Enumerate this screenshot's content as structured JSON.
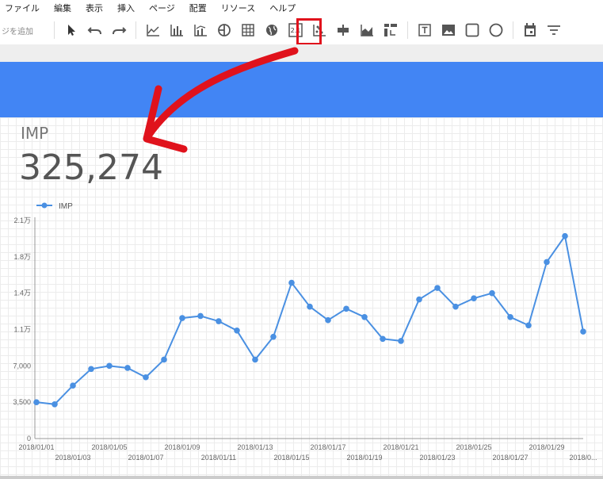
{
  "menu": [
    "ファイル",
    "編集",
    "表示",
    "挿入",
    "ページ",
    "配置",
    "リソース",
    "ヘルプ"
  ],
  "toolbar": {
    "add_page": "ジを追加",
    "scorecard_label": "2.1",
    "icons": [
      "select-icon",
      "undo-icon",
      "redo-icon",
      "time-series-icon",
      "bar-chart-icon",
      "combo-chart-icon",
      "pie-chart-icon",
      "table-icon",
      "geo-map-icon",
      "scorecard-icon",
      "scatter-icon",
      "bullet-chart-icon",
      "area-chart-icon",
      "pivot-table-icon",
      "text-icon",
      "image-icon",
      "rectangle-icon",
      "circle-icon",
      "date-range-icon",
      "filter-icon"
    ]
  },
  "scorecard": {
    "label": "IMP",
    "value": "325,274"
  },
  "colors": {
    "accent": "#4285f4",
    "highlight": "#e0121c",
    "line": "#4a90e2"
  },
  "chart_data": {
    "type": "line",
    "legend": "IMP",
    "legend_position": "top-left",
    "grid": true,
    "ylim": [
      0,
      21000
    ],
    "y_ticks": [
      0,
      3500,
      7000,
      10500,
      14000,
      17500,
      21000
    ],
    "y_tick_labels": [
      "0",
      "3,500",
      "7,000",
      "1.1万",
      "1.4万",
      "1.8万",
      "2.1万"
    ],
    "x": [
      "2018/01/01",
      "2018/01/02",
      "2018/01/03",
      "2018/01/04",
      "2018/01/05",
      "2018/01/06",
      "2018/01/07",
      "2018/01/08",
      "2018/01/09",
      "2018/01/10",
      "2018/01/11",
      "2018/01/12",
      "2018/01/13",
      "2018/01/14",
      "2018/01/15",
      "2018/01/16",
      "2018/01/17",
      "2018/01/18",
      "2018/01/19",
      "2018/01/20",
      "2018/01/21",
      "2018/01/22",
      "2018/01/23",
      "2018/01/24",
      "2018/01/25",
      "2018/01/26",
      "2018/01/27",
      "2018/01/28",
      "2018/01/29",
      "2018/01/30",
      "2018/01/31"
    ],
    "x_tick_labels": [
      "2018/01/01",
      "2018/01/03",
      "2018/01/05",
      "2018/01/07",
      "2018/01/09",
      "2018/01/11",
      "2018/01/13",
      "2018/01/15",
      "2018/01/17",
      "2018/01/19",
      "2018/01/21",
      "2018/01/23",
      "2018/01/25",
      "2018/01/27",
      "2018/01/29",
      "2018/0..."
    ],
    "series": [
      {
        "name": "IMP",
        "values": [
          3500,
          3300,
          5100,
          6700,
          7000,
          6800,
          5900,
          7600,
          11600,
          11800,
          11300,
          10400,
          7600,
          9800,
          15000,
          12700,
          11400,
          12500,
          11700,
          9600,
          9400,
          13400,
          14500,
          12700,
          13500,
          14000,
          11700,
          10900,
          17000,
          19500,
          10300
        ]
      }
    ]
  }
}
